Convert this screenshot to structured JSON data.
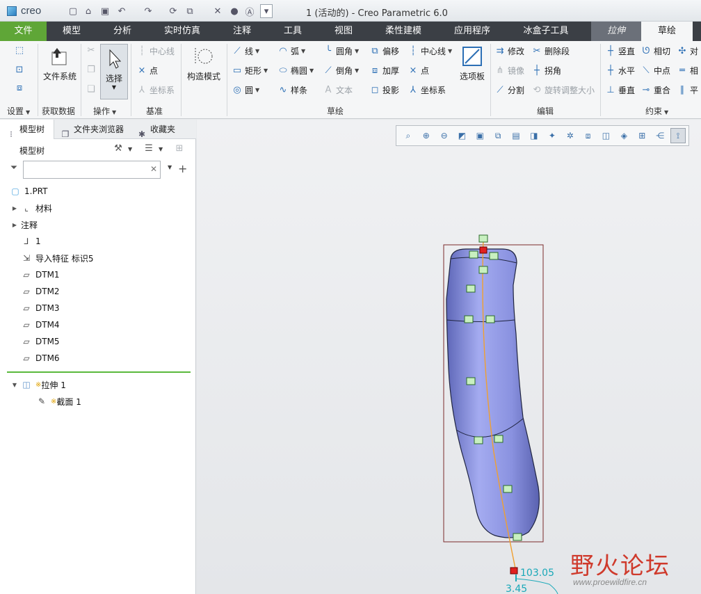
{
  "app": {
    "logo": "creo",
    "window_title": "1 (活动的) - Creo Parametric 6.0"
  },
  "tabs": [
    {
      "label": "文件"
    },
    {
      "label": "模型"
    },
    {
      "label": "分析"
    },
    {
      "label": "实时仿真"
    },
    {
      "label": "注释"
    },
    {
      "label": "工具"
    },
    {
      "label": "视图"
    },
    {
      "label": "柔性建模"
    },
    {
      "label": "应用程序"
    },
    {
      "label": "冰盒子工具"
    },
    {
      "label": "拉伸"
    },
    {
      "label": "草绘"
    }
  ],
  "ribbon": {
    "groups": {
      "setup": "设置",
      "get_data": "获取数据",
      "operations": "操作",
      "datum": "基准",
      "sketching": "草绘",
      "editing": "编辑",
      "constrain": "约束"
    },
    "buttons": {
      "file_system": "文件系统",
      "select": "选择",
      "centerline_datum": "中心线",
      "point_datum": "点",
      "csys_datum": "坐标系",
      "construction_mode": "构造模式",
      "line": "线",
      "rectangle": "矩形",
      "circle": "圆",
      "arc": "弧",
      "ellipse": "椭圆",
      "spline": "样条",
      "fillet": "圆角",
      "chamfer": "倒角",
      "text": "文本",
      "offset": "偏移",
      "thicken": "加厚",
      "project": "投影",
      "centerline": "中心线",
      "point": "点",
      "csys": "坐标系",
      "palette": "选项板",
      "modify": "修改",
      "delete_segment": "删除段",
      "mirror": "镜像",
      "corner": "拐角",
      "divide": "分割",
      "rotate_resize": "旋转调整大小",
      "vertical": "竖直",
      "tangent": "相切",
      "symmetric": "对",
      "horizontal": "水平",
      "midpoint": "中点",
      "equal": "相",
      "perpendicular": "垂直",
      "coincident": "重合",
      "parallel": "平"
    }
  },
  "left_panel": {
    "tabs": [
      {
        "label": "模型树"
      },
      {
        "label": "文件夹浏览器"
      },
      {
        "label": "收藏夹"
      }
    ],
    "tree_title": "模型树",
    "filter_placeholder": "",
    "nodes": [
      {
        "label": "1.PRT"
      },
      {
        "label": "材料"
      },
      {
        "label": "注释"
      },
      {
        "label": "1"
      },
      {
        "label": "导入特征 标识5"
      },
      {
        "label": "DTM1"
      },
      {
        "label": "DTM2"
      },
      {
        "label": "DTM3"
      },
      {
        "label": "DTM4"
      },
      {
        "label": "DTM5"
      },
      {
        "label": "DTM6"
      },
      {
        "label": "拉伸 1"
      },
      {
        "label": "截面 1"
      }
    ]
  },
  "graphics": {
    "dimensions": [
      {
        "value": "103.05"
      },
      {
        "value": "3.45"
      }
    ],
    "colors": {
      "part": "#8f97e0",
      "sketch_curve": "#f0a030",
      "dim": "#19a8b8",
      "bbox": "#7a2a2a"
    }
  },
  "watermark": {
    "main": "野火论坛",
    "url": "www.proewildfire.cn"
  }
}
